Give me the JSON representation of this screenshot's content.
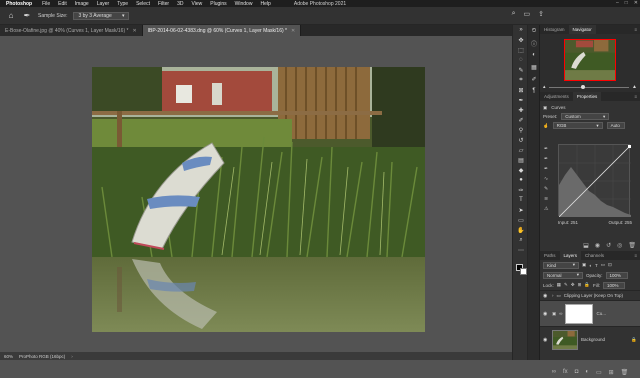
{
  "app": {
    "name": "Photoshop",
    "window_title": "Adobe Photoshop 2021",
    "menu": [
      "File",
      "Edit",
      "Image",
      "Layer",
      "Type",
      "Select",
      "Filter",
      "3D",
      "View",
      "Plugins",
      "Window",
      "Help"
    ]
  },
  "options": {
    "sample_size_label": "Sample Size:",
    "sample_size_value": "3 by 3 Average"
  },
  "tabs": [
    {
      "label": "E-Bose-Olafine.jpg @ 40% (Curves 1, Layer Mask/16) *",
      "active": false
    },
    {
      "label": "IBP-2014-06-02-4383.dng @ 60% (Curves 1, Layer Mask/16) *",
      "active": true
    }
  ],
  "status": {
    "zoom": "60%",
    "profile": "ProPhoto RGB (16bpc)"
  },
  "navigator": {
    "tabs": [
      "Histogram",
      "Navigator"
    ],
    "active": "Navigator"
  },
  "properties": {
    "tabs": [
      "Adjustments",
      "Properties"
    ],
    "active": "Properties",
    "adjustment_name": "Curves",
    "preset_label": "Preset:",
    "preset_value": "Custom",
    "channel_value": "RGB",
    "auto_label": "Auto",
    "input_label": "Input:",
    "input_value": "251",
    "output_label": "Output:",
    "output_value": "255"
  },
  "layers": {
    "tabs": [
      "Paths",
      "Layers",
      "Channels"
    ],
    "active": "Layers",
    "filter_value": "Kind",
    "blend_mode": "Normal",
    "opacity_label": "Opacity:",
    "opacity_value": "100%",
    "lock_label": "Lock:",
    "fill_label": "Fill:",
    "fill_value": "100%",
    "items": [
      {
        "name": "Clipping Layer (Keep On Top)",
        "type": "group"
      },
      {
        "name": "Cu...",
        "type": "adjustment"
      },
      {
        "name": "Background",
        "type": "pixel"
      }
    ]
  },
  "colors": {
    "ui_dark": "#323232",
    "ui_darker": "#282828",
    "canvas": "#535353",
    "accent_red": "#ff0000"
  }
}
